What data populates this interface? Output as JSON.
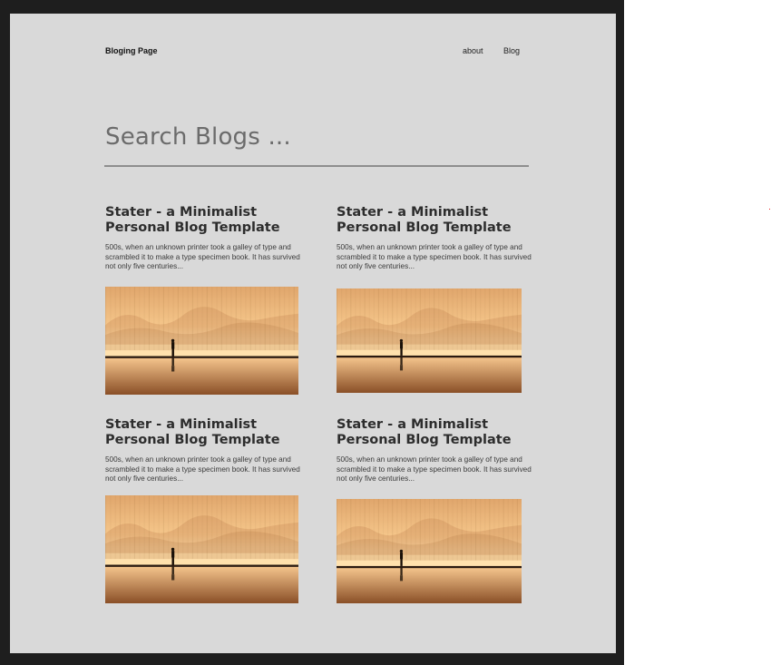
{
  "header": {
    "brand": "Bloging Page",
    "nav": [
      "about",
      "Blog"
    ]
  },
  "search": {
    "placeholder": "Search Blogs ..."
  },
  "posts": [
    {
      "title": "Stater - a Minimalist Personal Blog Template",
      "excerpt": "500s, when an unknown printer took a galley of type and scrambled it to make a type specimen book. It has survived not only five centuries...",
      "image": "silhouette-sunset-scene"
    },
    {
      "title": "Stater - a Minimalist Personal Blog Template",
      "excerpt": "500s, when an unknown printer took a galley of type and scrambled it to make a type specimen book. It has survived not only five centuries...",
      "image": "silhouette-sunset-scene"
    },
    {
      "title": "Stater - a Minimalist Personal Blog Template",
      "excerpt": "500s, when an unknown printer took a galley of type and scrambled it to make a type specimen book. It has survived not only five centuries...",
      "image": "silhouette-sunset-scene"
    },
    {
      "title": "Stater - a Minimalist Personal Blog Template",
      "excerpt": "500s, when an unknown printer took a galley of type and scrambled it to make a type specimen book. It has survived not only five centuries...",
      "image": "silhouette-sunset-scene"
    }
  ],
  "colors": {
    "canvas": "#1e1e1e",
    "artboard": "#d9d9d9",
    "text": "#2d2d2d",
    "image_warm": "#f0b070"
  }
}
